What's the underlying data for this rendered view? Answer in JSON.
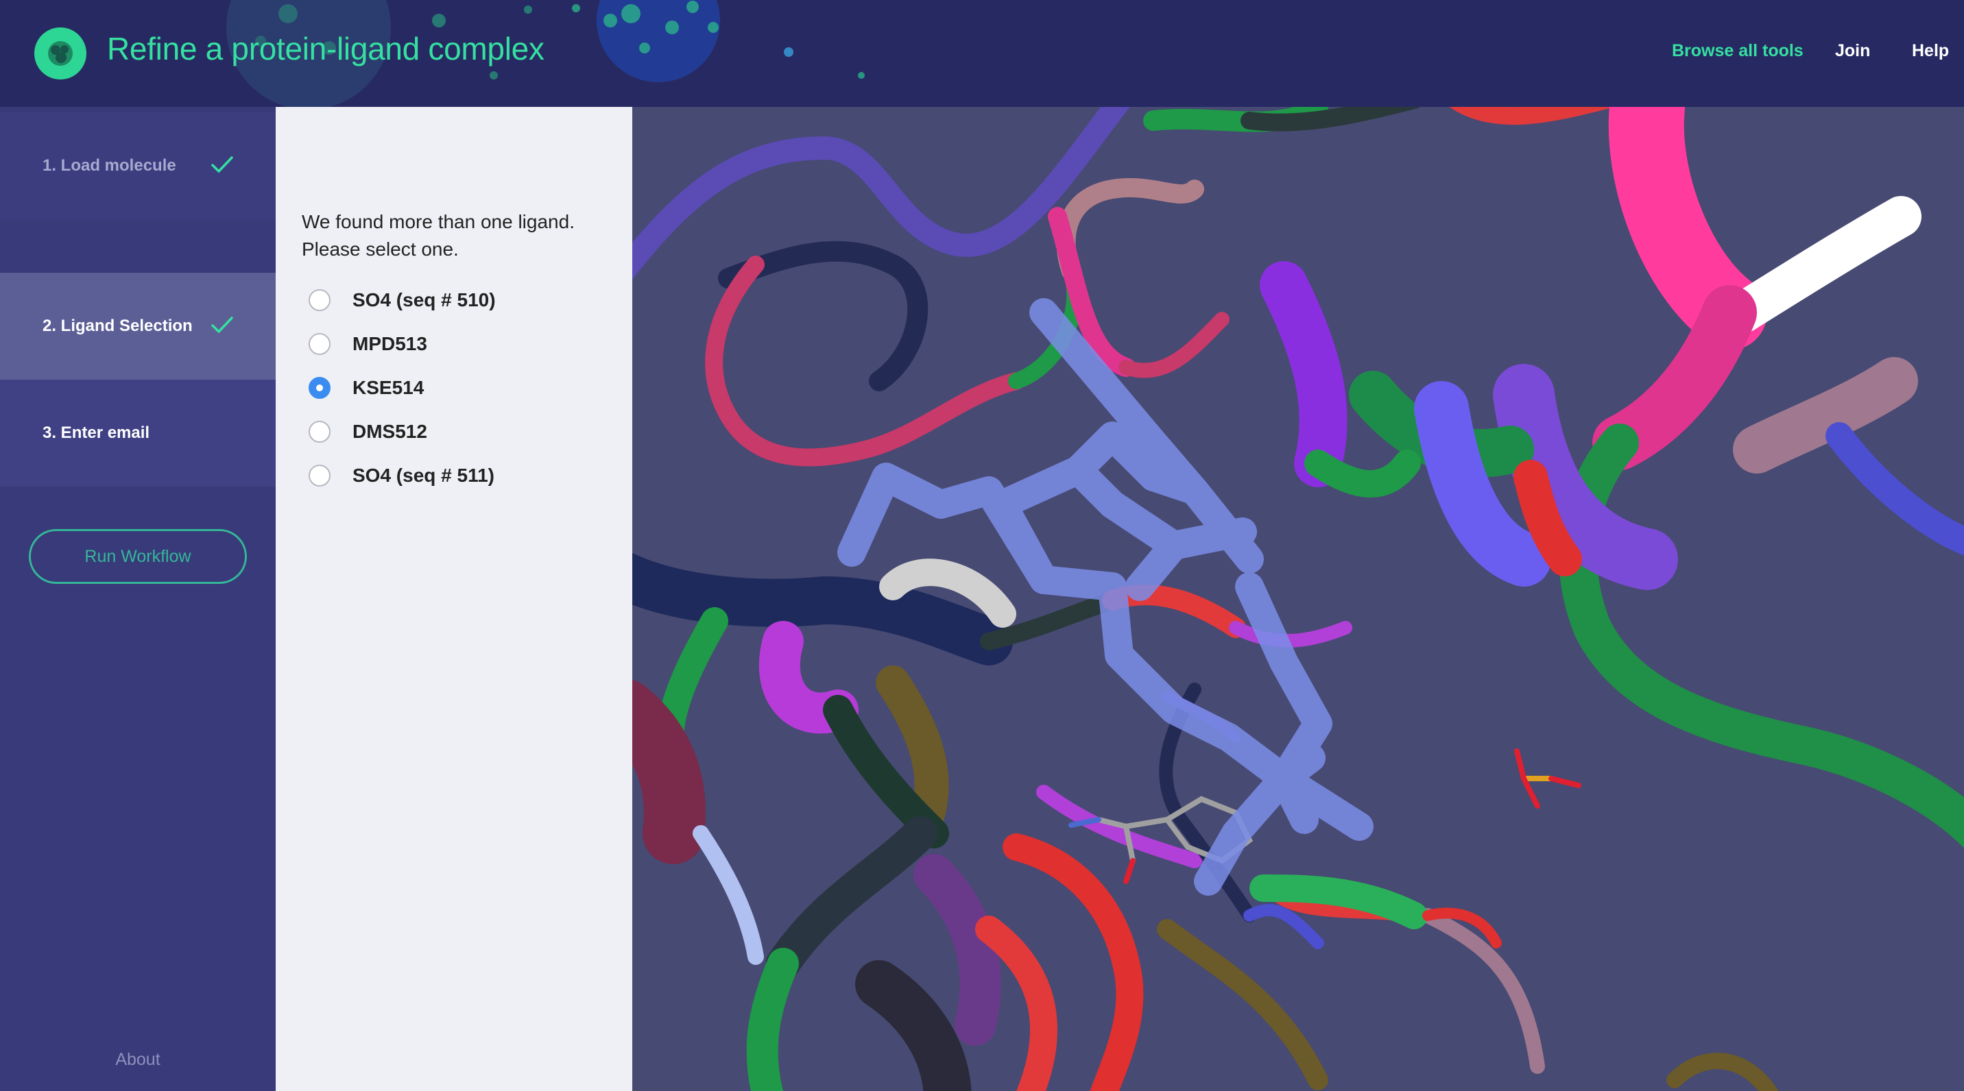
{
  "header": {
    "title": "Refine a protein-ligand complex",
    "nav": {
      "browse_all_tools": "Browse all tools",
      "join": "Join",
      "help": "Help"
    }
  },
  "sidebar": {
    "steps": [
      {
        "label": "1. Load molecule",
        "completed": true
      },
      {
        "label": "2. Ligand Selection",
        "completed": true,
        "active": true
      },
      {
        "label": "3. Enter email",
        "completed": false
      }
    ],
    "run_button": "Run Workflow",
    "about": "About"
  },
  "ligand_selection": {
    "prompt_line1": "We found more than one ligand.",
    "prompt_line2": "Please select one.",
    "options": [
      {
        "label": "SO4 (seq # 510)",
        "selected": false
      },
      {
        "label": "MPD513",
        "selected": false
      },
      {
        "label": "KSE514",
        "selected": true
      },
      {
        "label": "DMS512",
        "selected": false
      },
      {
        "label": "SO4 (seq # 511)",
        "selected": false
      }
    ]
  },
  "colors": {
    "accent": "#35e0a1",
    "header_bg": "#272a62",
    "sidebar_bg": "#383a7a",
    "active_step_bg": "#5c5f96",
    "panel_bg": "#eff0f5",
    "viewer_bg": "#474a72",
    "radio_selected": "#3b8cf0"
  }
}
